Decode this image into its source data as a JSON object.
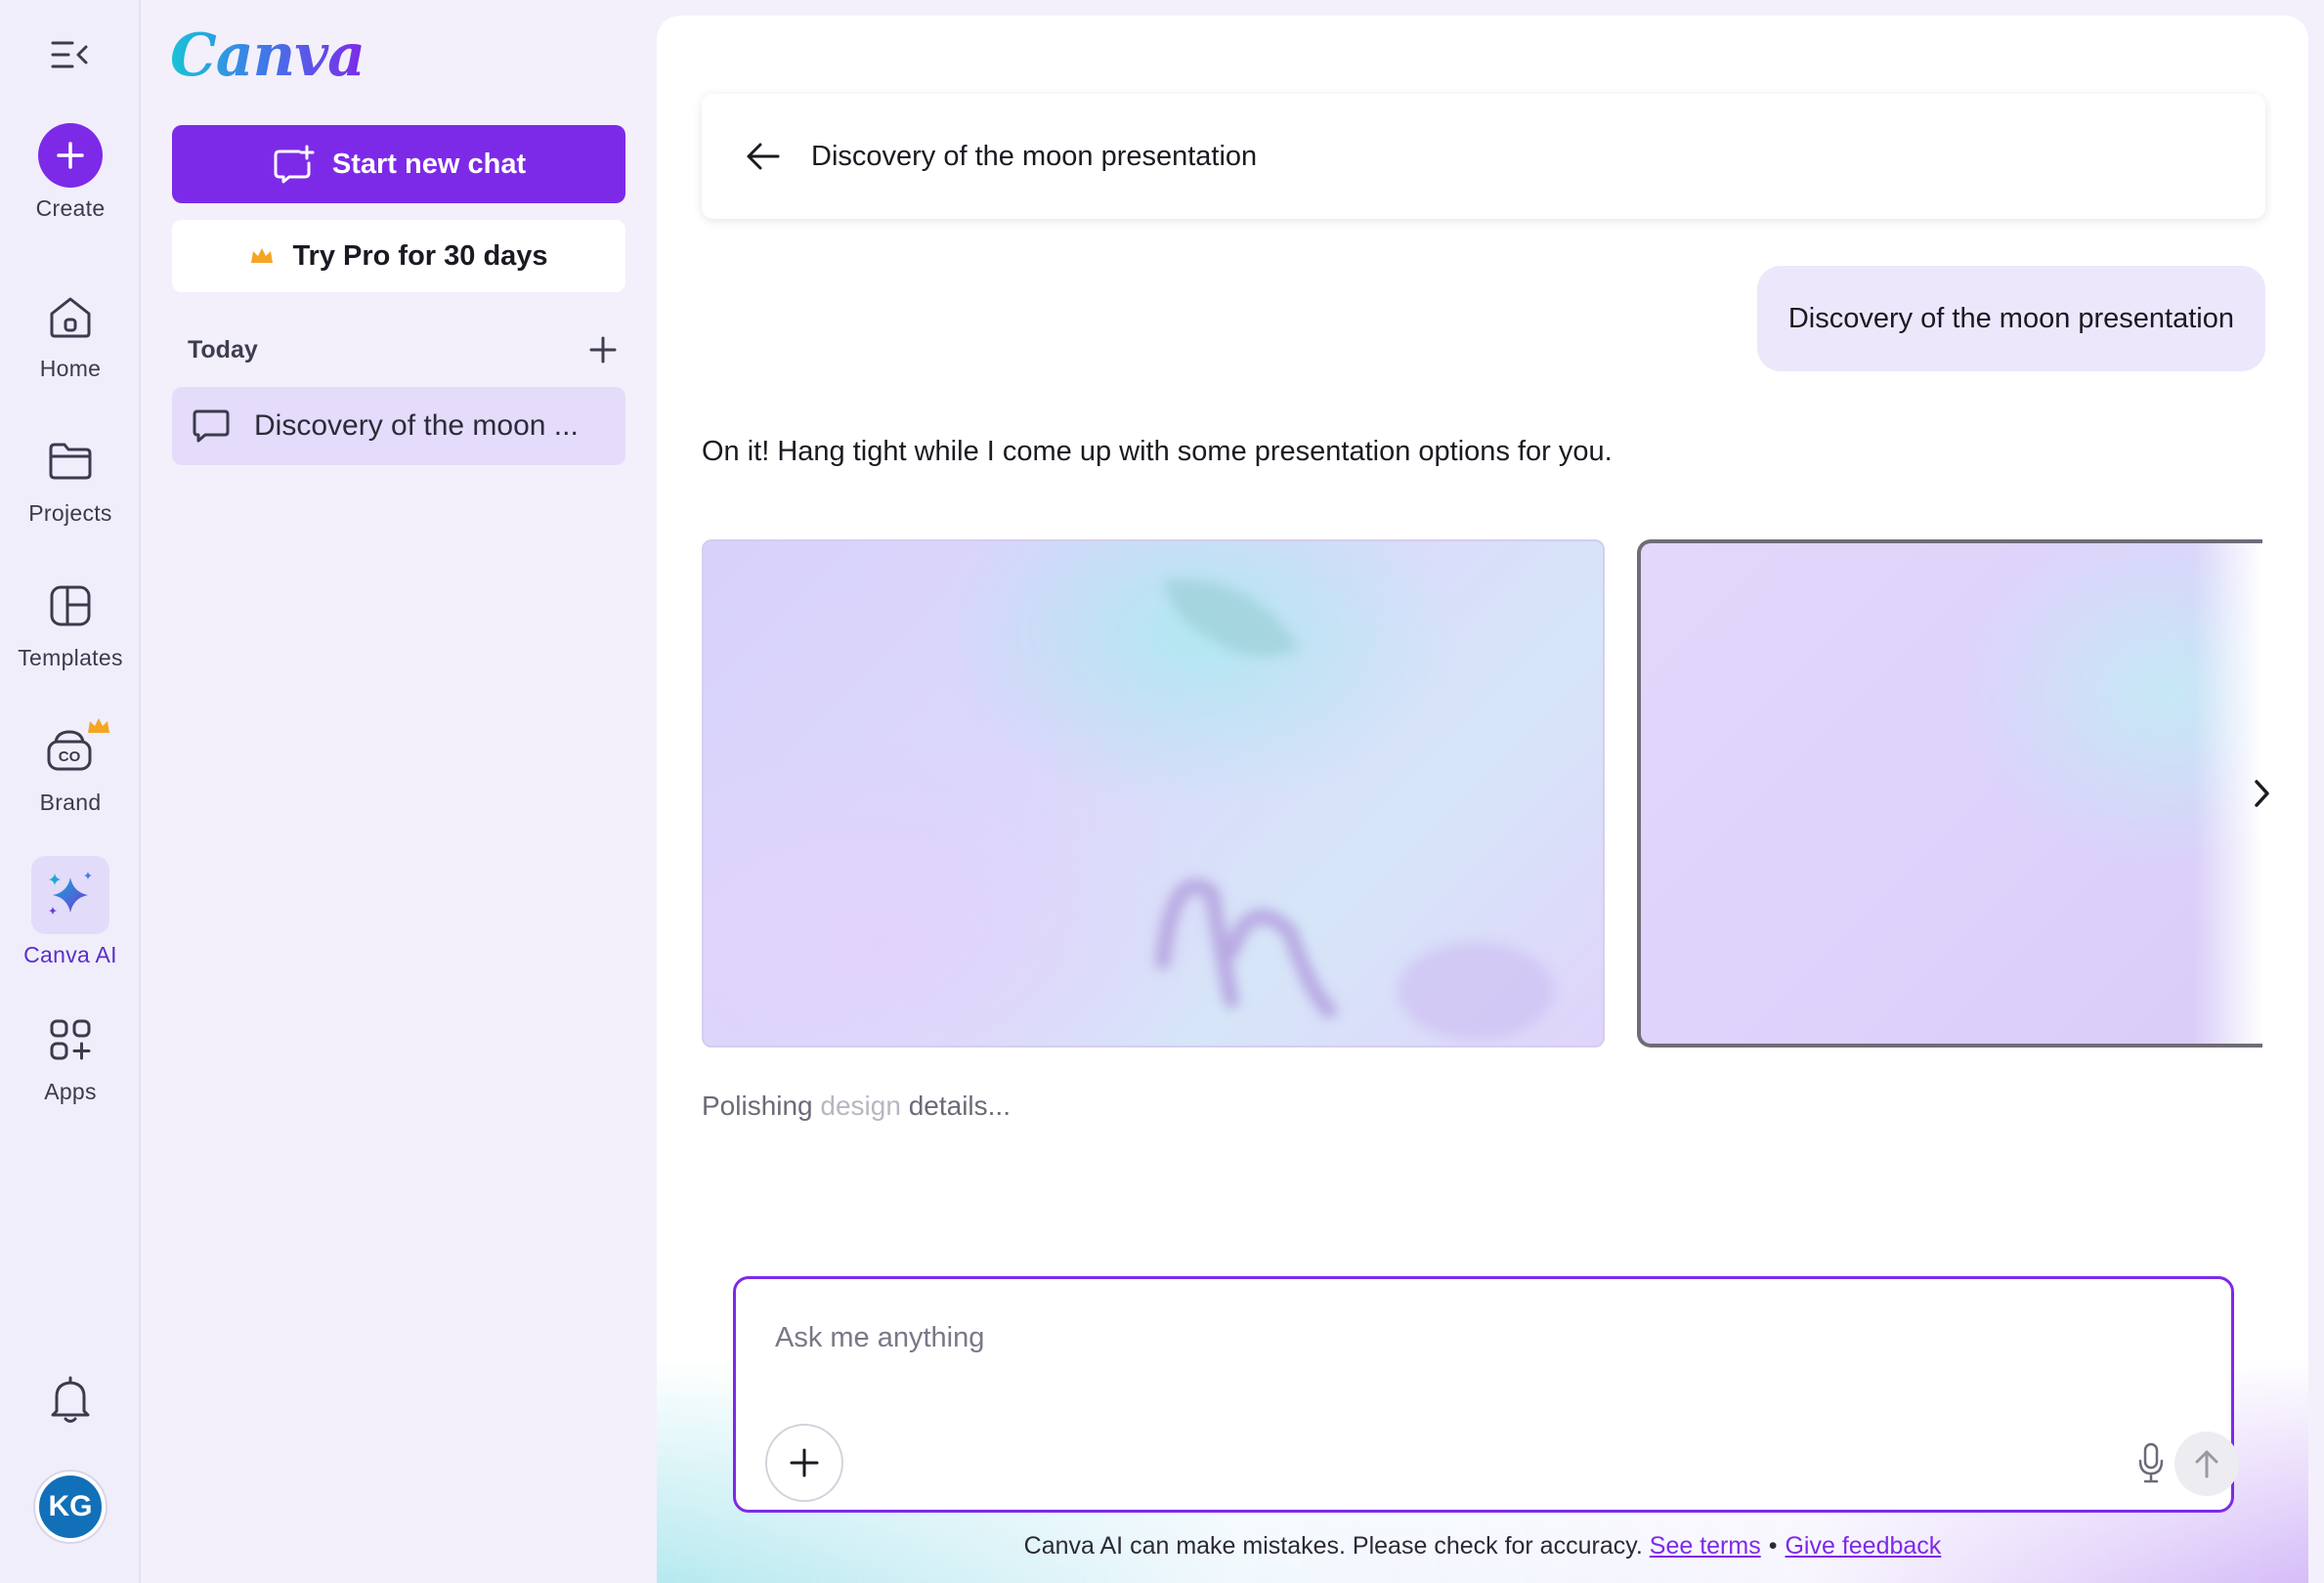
{
  "rail": {
    "create_label": "Create",
    "items": [
      {
        "label": "Home",
        "icon": "home-icon"
      },
      {
        "label": "Projects",
        "icon": "folder-icon"
      },
      {
        "label": "Templates",
        "icon": "templates-icon"
      },
      {
        "label": "Brand",
        "icon": "brand-icon"
      },
      {
        "label": "Canva AI",
        "icon": "sparkle-icon"
      },
      {
        "label": "Apps",
        "icon": "apps-icon"
      }
    ],
    "avatar_initials": "KG"
  },
  "panel": {
    "logo": "Canva",
    "new_chat_label": "Start new chat",
    "try_pro_label": "Try Pro for 30 days",
    "section_label": "Today",
    "history": [
      {
        "title": "Discovery of the moon ..."
      }
    ]
  },
  "chat": {
    "title": "Discovery of the moon presentation",
    "user_message": "Discovery of the moon presentation",
    "ai_message": "On it! Hang tight while I come up with some presentation options for you.",
    "status": {
      "part1": "Polishing ",
      "part2": "design",
      "part3": " details..."
    }
  },
  "composer": {
    "placeholder": "Ask me anything"
  },
  "footer": {
    "disclaimer": "Canva AI can make mistakes. Please check for accuracy.",
    "terms_link": "See terms",
    "separator": "•",
    "feedback_link": "Give feedback"
  },
  "colors": {
    "accent": "#7d2ae8",
    "avatar": "#1270b8",
    "crown": "#f5a524"
  }
}
